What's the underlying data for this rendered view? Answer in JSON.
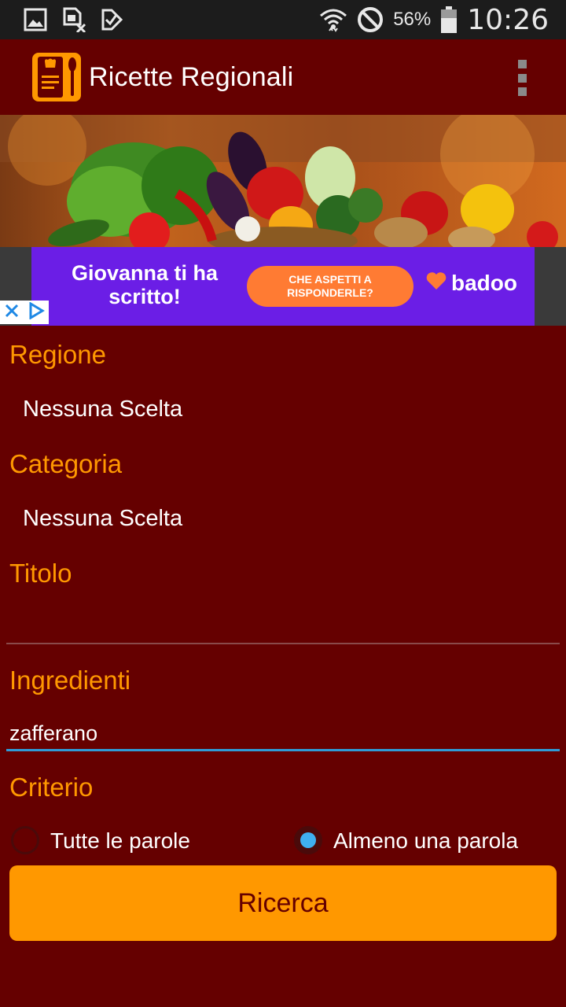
{
  "status_bar": {
    "icons_left": [
      "gallery-icon",
      "sim-card-icon",
      "task-check-icon"
    ],
    "battery": "56%",
    "time": "10:26"
  },
  "app": {
    "title": "Ricette Regionali"
  },
  "ad": {
    "text": "Giovanna ti ha scritto!",
    "cta": "CHE ASPETTI A RISPONDERLE?",
    "brand": "badoo"
  },
  "form": {
    "regione": {
      "label": "Regione",
      "value": "Nessuna Scelta"
    },
    "categoria": {
      "label": "Categoria",
      "value": "Nessuna Scelta"
    },
    "titolo": {
      "label": "Titolo",
      "value": ""
    },
    "ingredienti": {
      "label": "Ingredienti",
      "value": "zafferano"
    },
    "criterio": {
      "label": "Criterio",
      "options": [
        "Tutte le parole",
        "Almeno una parola"
      ],
      "selected": "Almeno una parola"
    },
    "search_button": "Ricerca"
  },
  "colors": {
    "background": "#650000",
    "accent": "#ff9800",
    "status_bar": "#1c1c1c",
    "ad_purple": "#6b1ee6",
    "input_underline_active": "#2f9bd6"
  }
}
